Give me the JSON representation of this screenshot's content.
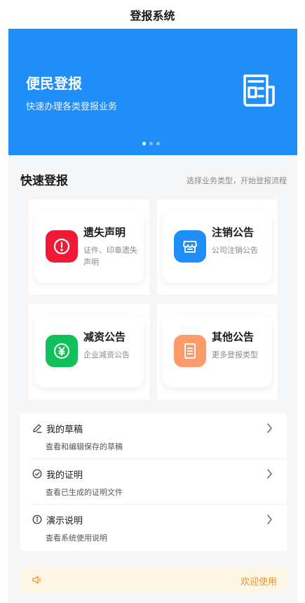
{
  "app": {
    "title": "登报系统"
  },
  "banner": {
    "title": "便民登报",
    "subtitle": "快速办理各类登报业务",
    "icon": "newspaper-icon",
    "slides": 3,
    "active_slide": 1
  },
  "quick": {
    "title": "快速登报",
    "hint": "选择业务类型，开始登报流程",
    "cards": [
      {
        "title": "遗失声明",
        "desc": "证件、印章遗失声明",
        "icon": "alert-circle-icon",
        "color": "#ee1a36"
      },
      {
        "title": "注销公告",
        "desc": "公司注销公告",
        "icon": "shop-icon",
        "color": "#1f8ef8"
      },
      {
        "title": "减资公告",
        "desc": "企业减资公告",
        "icon": "yen-coin-icon",
        "color": "#10c05a"
      },
      {
        "title": "其他公告",
        "desc": "更多登报类型",
        "icon": "document-icon",
        "color": "#ff9a6a"
      }
    ]
  },
  "menu": {
    "items": [
      {
        "title": "我的草稿",
        "subtitle": "查看和编辑保存的草稿",
        "icon": "pencil-icon"
      },
      {
        "title": "我的证明",
        "subtitle": "查看已生成的证明文件",
        "icon": "check-circle-icon"
      },
      {
        "title": "演示说明",
        "subtitle": "查看系统使用说明",
        "icon": "info-circle-icon"
      }
    ]
  },
  "notice": {
    "text": "欢迎使用",
    "icon": "speaker-icon",
    "color": "#f0902c"
  }
}
